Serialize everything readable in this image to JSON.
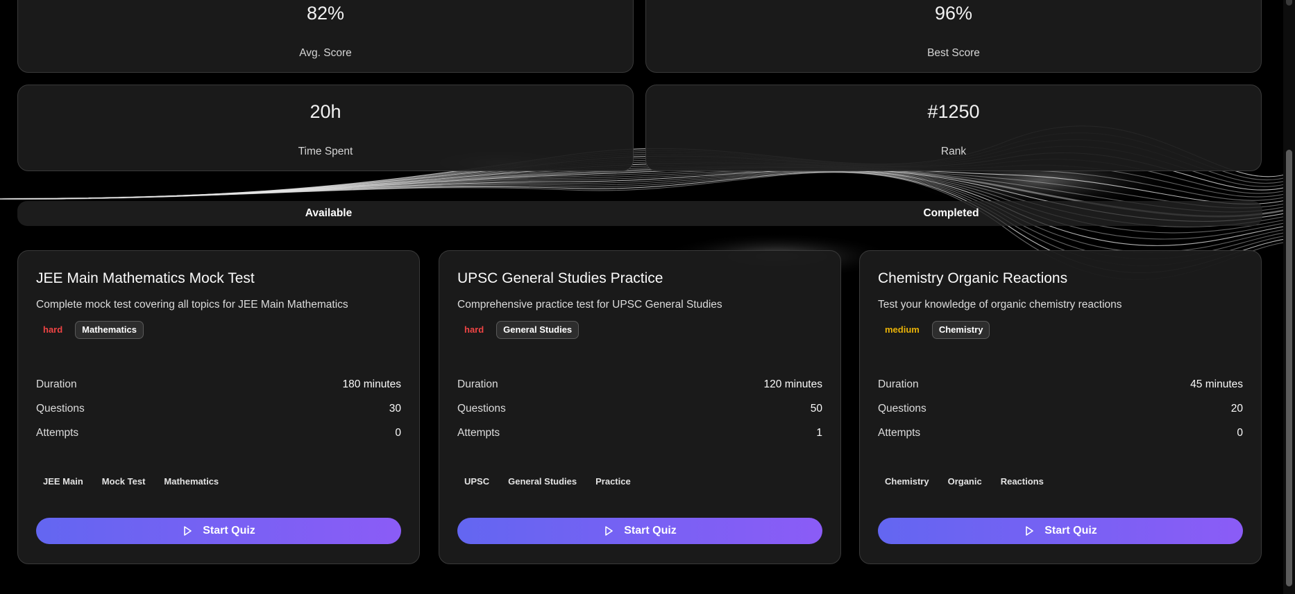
{
  "stats": [
    {
      "value": "82%",
      "label": "Avg. Score"
    },
    {
      "value": "96%",
      "label": "Best Score"
    },
    {
      "value": "20h",
      "label": "Time Spent"
    },
    {
      "value": "#1250",
      "label": "Rank"
    }
  ],
  "tabs": [
    {
      "label": "Available",
      "active": true
    },
    {
      "label": "Completed",
      "active": false
    }
  ],
  "quizzes": [
    {
      "title": "JEE Main Mathematics Mock Test",
      "description": "Complete mock test covering all topics for JEE Main Mathematics",
      "difficulty": "hard",
      "subject": "Mathematics",
      "duration_label": "Duration",
      "duration": "180 minutes",
      "questions_label": "Questions",
      "questions": "30",
      "attempts_label": "Attempts",
      "attempts": "0",
      "tags": [
        "JEE Main",
        "Mock Test",
        "Mathematics"
      ],
      "button": "Start Quiz"
    },
    {
      "title": "UPSC General Studies Practice",
      "description": "Comprehensive practice test for UPSC General Studies",
      "difficulty": "hard",
      "subject": "General Studies",
      "duration_label": "Duration",
      "duration": "120 minutes",
      "questions_label": "Questions",
      "questions": "50",
      "attempts_label": "Attempts",
      "attempts": "1",
      "tags": [
        "UPSC",
        "General Studies",
        "Practice"
      ],
      "button": "Start Quiz"
    },
    {
      "title": "Chemistry Organic Reactions",
      "description": "Test your knowledge of organic chemistry reactions",
      "difficulty": "medium",
      "subject": "Chemistry",
      "duration_label": "Duration",
      "duration": "45 minutes",
      "questions_label": "Questions",
      "questions": "20",
      "attempts_label": "Attempts",
      "attempts": "0",
      "tags": [
        "Chemistry",
        "Organic",
        "Reactions"
      ],
      "button": "Start Quiz"
    }
  ],
  "colors": {
    "background": "#000000",
    "card": "#1b1b1b",
    "hard": "#ef4444",
    "medium": "#eab308",
    "button_start": "#6366f1",
    "button_end": "#8b5cf6"
  },
  "icons": {
    "start_button": "play-icon"
  }
}
